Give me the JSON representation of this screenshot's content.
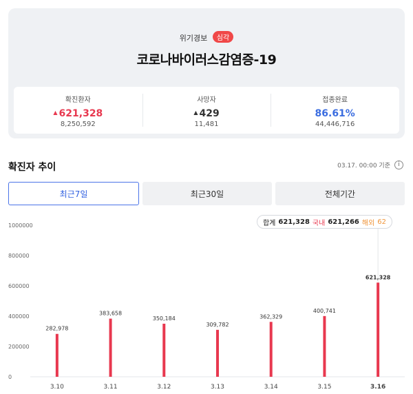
{
  "header": {
    "alert_label": "위기경보",
    "alert_badge": "심각",
    "title": "코로나바이러스감염증-19"
  },
  "stats": {
    "confirmed": {
      "label": "확진환자",
      "arrow": "▲",
      "value": "621,328",
      "total": "8,250,592"
    },
    "deaths": {
      "label": "사망자",
      "arrow": "▲",
      "value": "429",
      "total": "11,481"
    },
    "vaccinated": {
      "label": "접종완료",
      "value": "86.61%",
      "total": "44,446,716"
    }
  },
  "section": {
    "title": "확진자 추이",
    "update": "03.17. 00:00 기준",
    "info_icon": "info-icon"
  },
  "tabs": [
    "최근7일",
    "최근30일",
    "전체기간"
  ],
  "tooltip": {
    "total_label": "합계",
    "total_value": "621,328",
    "domestic_label": "국내",
    "domestic_value": "621,266",
    "overseas_label": "해외",
    "overseas_value": "62"
  },
  "colors": {
    "bar": "#e8384f",
    "accent_blue": "#3b6de0"
  },
  "chart_data": {
    "type": "bar",
    "categories": [
      "3.10",
      "3.11",
      "3.12",
      "3.13",
      "3.14",
      "3.15",
      "3.16"
    ],
    "values": [
      282978,
      383658,
      350184,
      309782,
      362329,
      400741,
      621328
    ],
    "value_labels": [
      "282,978",
      "383,658",
      "350,184",
      "309,782",
      "362,329",
      "400,741",
      "621,328"
    ],
    "y_ticks": [
      "0",
      "200000",
      "400000",
      "600000",
      "800000",
      "1000000"
    ],
    "ylim": [
      0,
      1000000
    ],
    "highlight_index": 6,
    "grid": false
  }
}
